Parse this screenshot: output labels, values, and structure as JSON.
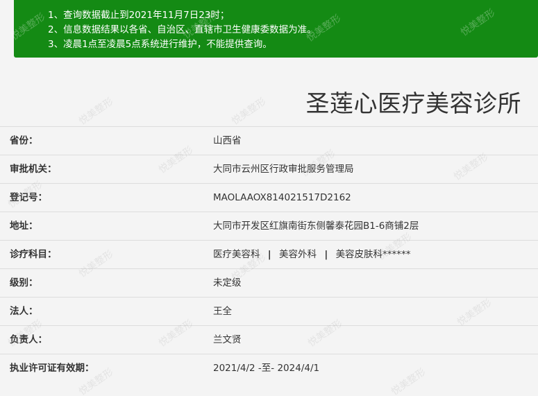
{
  "notice": {
    "lines": [
      "1、查询数据截止到2021年11月7日23时；",
      "2、信息数据结果以各省、自治区、直辖市卫生健康委数据为准。",
      "3、凌晨1点至凌晨5点系统进行维护，不能提供查询。"
    ]
  },
  "clinic": {
    "title": "圣莲心医疗美容诊所"
  },
  "info_rows": [
    {
      "label": "省份：",
      "value": "山西省"
    },
    {
      "label": "审批机关：",
      "value": "大同市云州区行政审批服务管理局"
    },
    {
      "label": "登记号：",
      "value": "MAOLAAOX814021517D2162"
    },
    {
      "label": "地址：",
      "value": "大同市开发区红旗南街东侧馨泰花园B1-6商铺2层"
    },
    {
      "label": "诊疗科目：",
      "subjects": [
        "医疗美容科",
        "美容外科",
        "美容皮肤科******"
      ],
      "separator": "|"
    },
    {
      "label": "级别：",
      "value": "未定级"
    },
    {
      "label": "法人：",
      "value": "王全"
    },
    {
      "label": "负责人：",
      "value": "兰文贤"
    },
    {
      "label": "执业许可证有效期：",
      "value": "2021/4/2 -至- 2024/4/1"
    }
  ],
  "watermark": {
    "text": "悦美整形"
  },
  "colors": {
    "notice_bg": "#148a14",
    "text": "#333333",
    "row_border": "#dcdcdc"
  }
}
